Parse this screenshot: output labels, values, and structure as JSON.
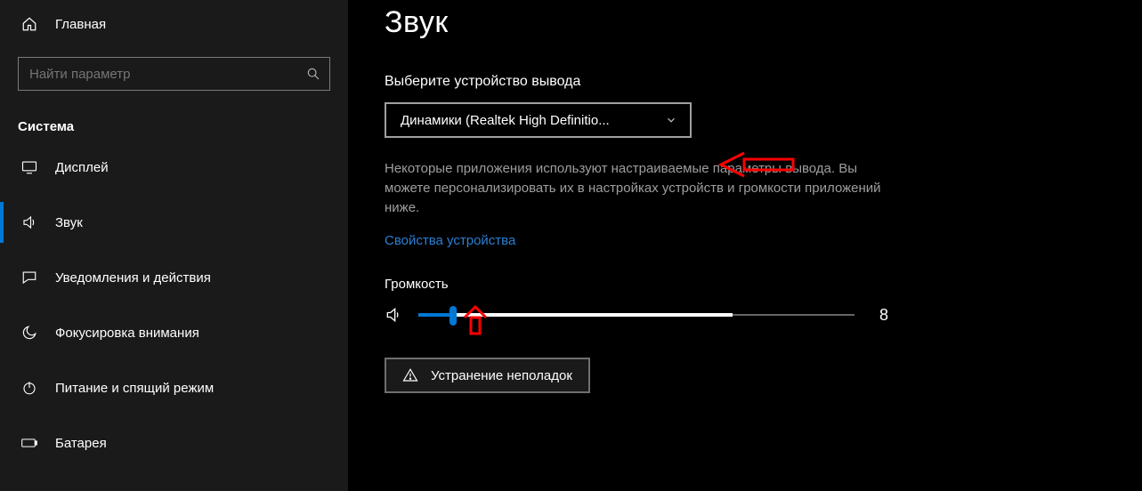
{
  "sidebar": {
    "home": "Главная",
    "search_placeholder": "Найти параметр",
    "category": "Система",
    "items": [
      {
        "icon": "display",
        "label": "Дисплей"
      },
      {
        "icon": "sound",
        "label": "Звук"
      },
      {
        "icon": "notify",
        "label": "Уведомления и действия"
      },
      {
        "icon": "focus",
        "label": "Фокусировка внимания"
      },
      {
        "icon": "power",
        "label": "Питание и спящий режим"
      },
      {
        "icon": "battery",
        "label": "Батарея"
      }
    ],
    "active_index": 1
  },
  "main": {
    "title": "Звук",
    "output_section_label": "Выберите устройство вывода",
    "output_device_selected": "Динамики (Realtek High Definitio...",
    "output_help": "Некоторые приложения используют настраиваемые параметры вывода. Вы можете персонализировать их в настройках устройств и громкости приложений ниже.",
    "device_properties_link": "Свойства устройства",
    "volume_label": "Громкость",
    "volume_value": 8,
    "volume_max": 100,
    "troubleshoot_label": "Устранение неполадок"
  },
  "annotations": {
    "arrow_color": "#ff0000"
  }
}
